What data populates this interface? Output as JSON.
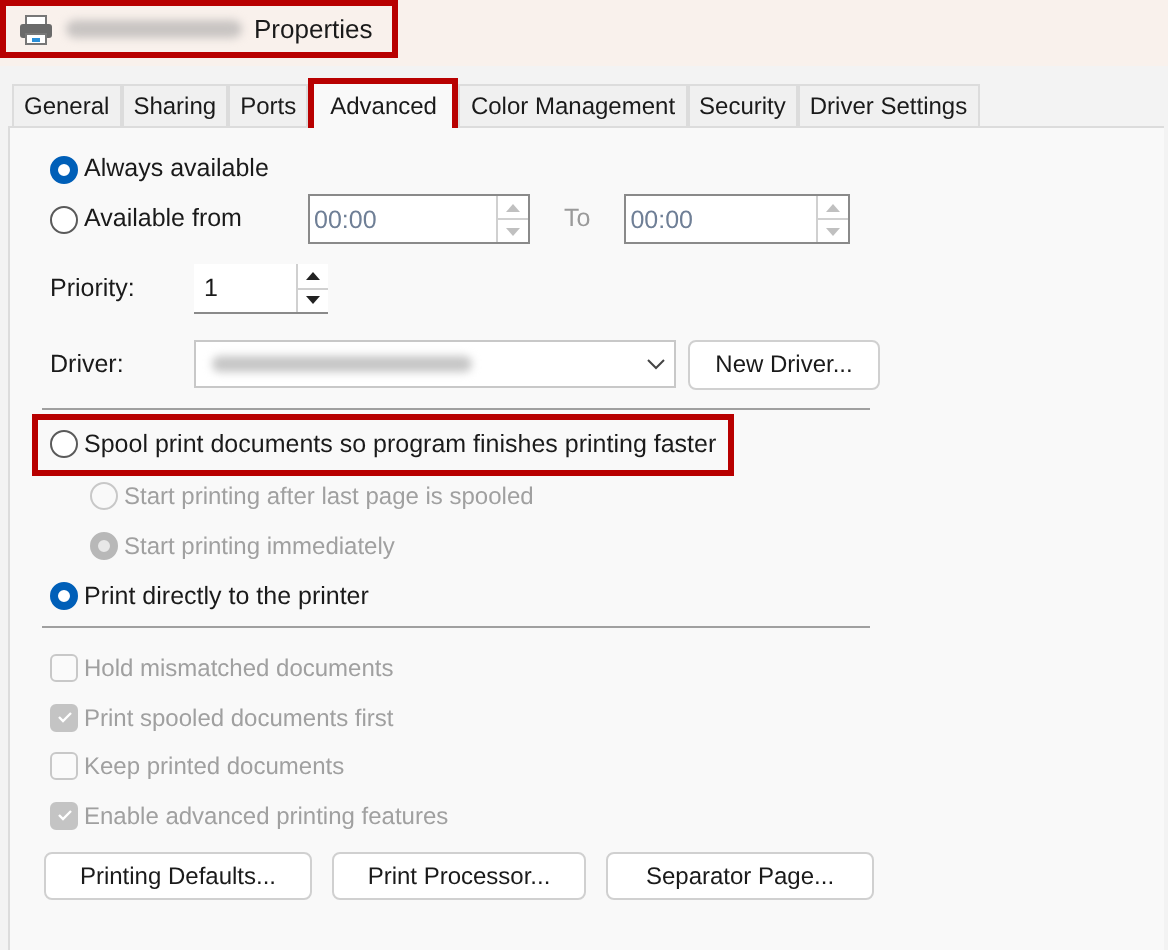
{
  "window": {
    "title": "Properties",
    "highlighted": true
  },
  "tabs": [
    {
      "label": "General",
      "selected": false,
      "highlighted": false
    },
    {
      "label": "Sharing",
      "selected": false,
      "highlighted": false
    },
    {
      "label": "Ports",
      "selected": false,
      "highlighted": false
    },
    {
      "label": "Advanced",
      "selected": true,
      "highlighted": true
    },
    {
      "label": "Color Management",
      "selected": false,
      "highlighted": false
    },
    {
      "label": "Security",
      "selected": false,
      "highlighted": false
    },
    {
      "label": "Driver Settings",
      "selected": false,
      "highlighted": false
    }
  ],
  "availability": [
    {
      "label": "Always available",
      "selected": true
    },
    {
      "label": "Available from",
      "selected": false
    }
  ],
  "time_from": {
    "value": "00:00",
    "disabled": true
  },
  "to_label": "To",
  "time_to": {
    "value": "00:00",
    "disabled": true
  },
  "priority": {
    "label": "Priority:",
    "value": "1"
  },
  "driver": {
    "label": "Driver:",
    "button": "New Driver..."
  },
  "spooling": [
    {
      "label": "Spool print documents so program finishes printing faster",
      "selected": false,
      "disabled": false,
      "highlighted": true,
      "children": [
        {
          "label": "Start printing after last page is spooled",
          "selected": false,
          "disabled": true,
          "highlighted": false
        },
        {
          "label": "Start printing immediately",
          "selected": true,
          "disabled": true,
          "highlighted": false
        }
      ]
    },
    {
      "label": "Print directly to the printer",
      "selected": true,
      "disabled": false,
      "highlighted": false
    }
  ],
  "checkboxes": [
    {
      "label": "Hold mismatched documents",
      "checked": false,
      "disabled": true
    },
    {
      "label": "Print spooled documents first",
      "checked": true,
      "disabled": true
    },
    {
      "label": "Keep printed documents",
      "checked": false,
      "disabled": true
    },
    {
      "label": "Enable advanced printing features",
      "checked": true,
      "disabled": true
    }
  ],
  "buttons": [
    "Printing Defaults...",
    "Print Processor...",
    "Separator Page..."
  ]
}
